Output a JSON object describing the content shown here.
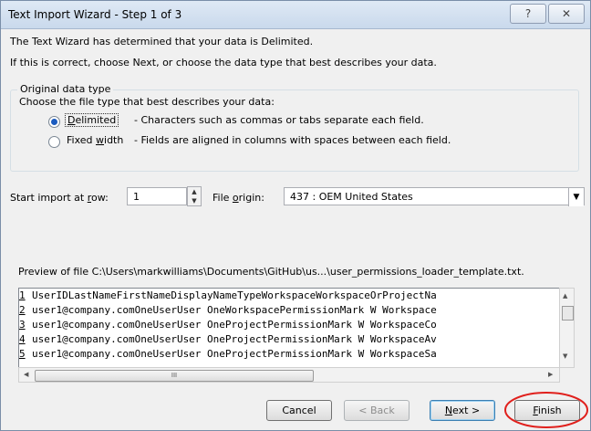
{
  "window": {
    "title": "Text Import Wizard - Step 1 of 3",
    "help_glyph": "?",
    "close_glyph": "✕"
  },
  "intro": {
    "line1": "The Text Wizard has determined that your data is Delimited.",
    "line2": "If this is correct, choose Next, or choose the data type that best describes your data."
  },
  "original_data_type": {
    "legend": "Original data type",
    "prompt": "Choose the file type that best describes your data:",
    "options": [
      {
        "label_pre": "",
        "label_ul": "D",
        "label_post": "elimited",
        "desc": "- Characters such as commas or tabs separate each field.",
        "checked": true
      },
      {
        "label_pre": "Fixed ",
        "label_ul": "w",
        "label_post": "idth",
        "desc": "- Fields are aligned in columns with spaces between each field.",
        "checked": false
      }
    ]
  },
  "start_row": {
    "label_pre": "Start import at ",
    "label_ul": "r",
    "label_post": "ow:",
    "value": "1"
  },
  "file_origin": {
    "label_pre": "File ",
    "label_ul": "o",
    "label_post": "rigin:",
    "value": "437 : OEM United States"
  },
  "preview": {
    "label": "Preview of file C:\\Users\\markwilliams\\Documents\\GitHub\\us...\\user_permissions_loader_template.txt.",
    "rows": [
      {
        "n": "1",
        "text": "UserIDLastNameFirstNameDisplayNameTypeWorkspaceWorkspaceOrProjectNa"
      },
      {
        "n": "2",
        "text": "user1@company.comOneUserUser OneWorkspacePermissionMark W Workspace"
      },
      {
        "n": "3",
        "text": "user1@company.comOneUserUser OneProjectPermissionMark W WorkspaceCo"
      },
      {
        "n": "4",
        "text": "user1@company.comOneUserUser OneProjectPermissionMark W WorkspaceAv"
      },
      {
        "n": "5",
        "text": "user1@company.comOneUserUser OneProjectPermissionMark W WorkspaceSa"
      }
    ],
    "hscroll_thumb": "III"
  },
  "buttons": {
    "cancel": "Cancel",
    "back": "< Back",
    "next_ul": "N",
    "next_post": "ext >",
    "finish_ul": "F",
    "finish_post": "inish"
  },
  "colors": {
    "highlight_circle": "#e0201c"
  }
}
